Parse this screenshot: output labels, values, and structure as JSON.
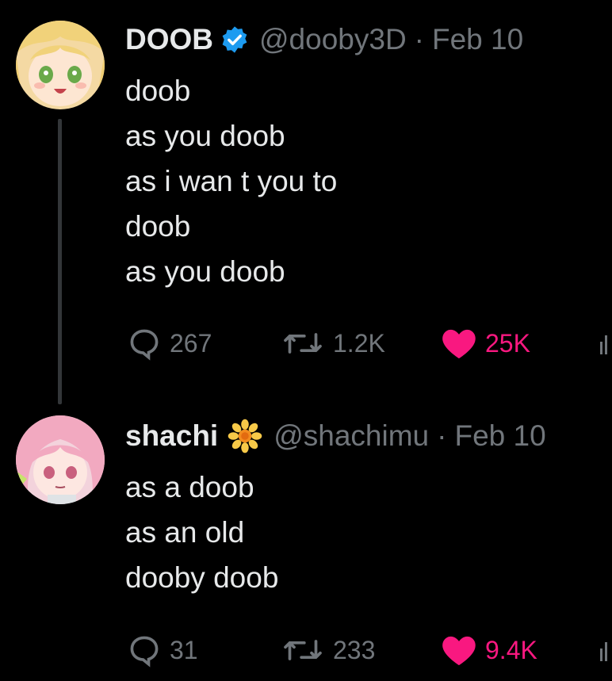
{
  "tweets": [
    {
      "name": "DOOB",
      "handle": "@dooby3D",
      "separator": "·",
      "date": "Feb 10",
      "badge_icon": "verified-check-icon",
      "lines": [
        "doob",
        "as you doob",
        "as i wan t you to",
        "doob",
        "as you doob"
      ],
      "replies": "267",
      "retweets": "1.2K",
      "likes": "25K"
    },
    {
      "name": "shachi",
      "handle": "@shachimu",
      "separator": "·",
      "date": "Feb 10",
      "badge_icon": "sunflower-icon",
      "lines": [
        "as a doob",
        "as an old",
        "dooby doob"
      ],
      "replies": "31",
      "retweets": "233",
      "likes": "9.4K"
    }
  ],
  "colors": {
    "background": "#000000",
    "text": "#e7e9ea",
    "secondary": "#71767b",
    "like": "#f91880",
    "verified": "#1d9bf0"
  }
}
